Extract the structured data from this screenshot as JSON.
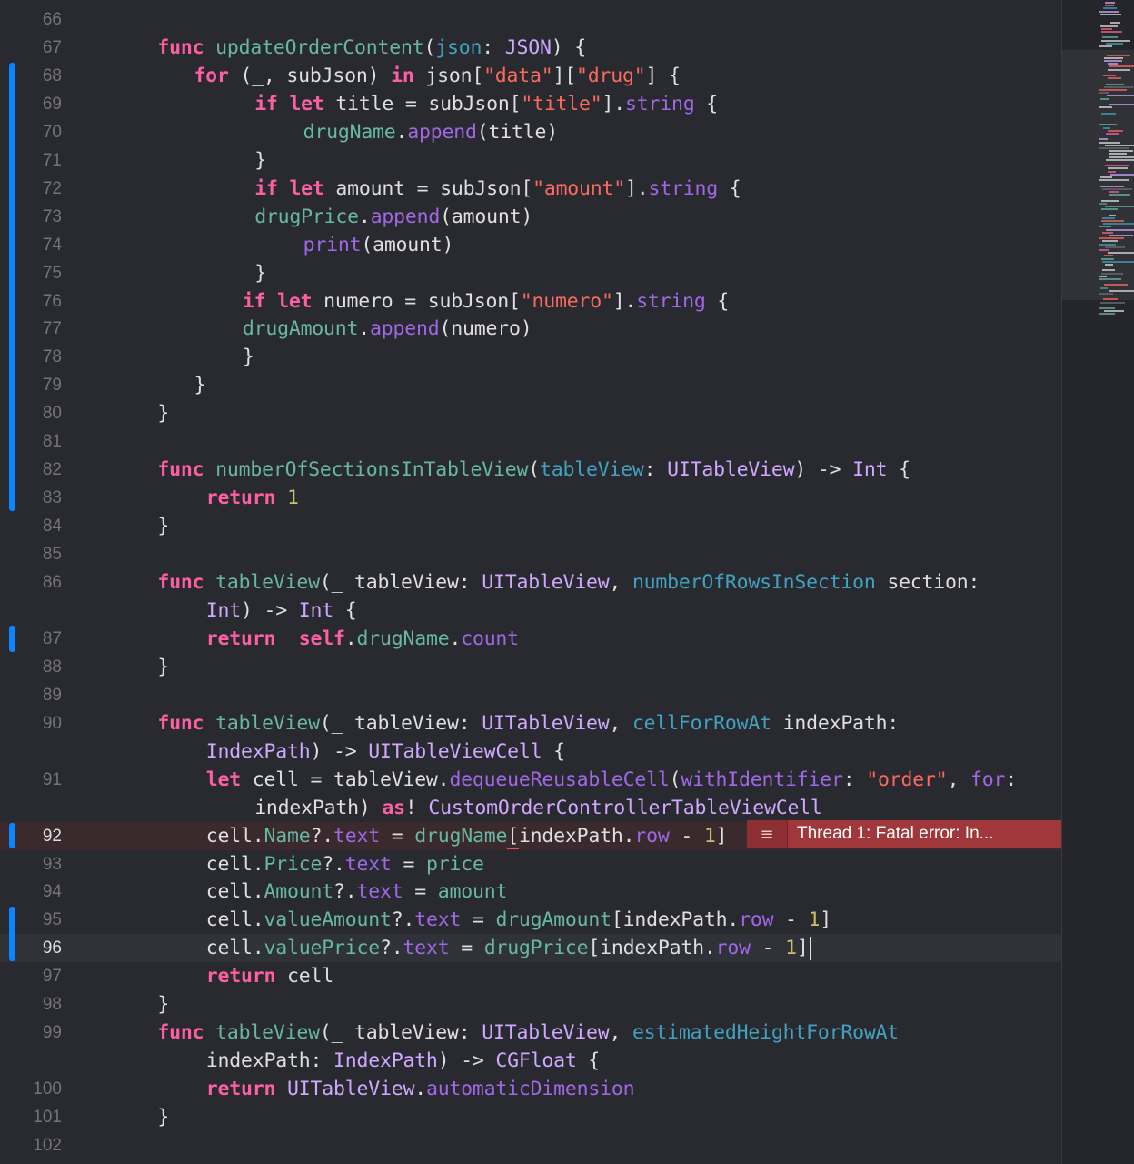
{
  "editor": {
    "lines": [
      {
        "num": "66",
        "indent": 0,
        "tokens": []
      },
      {
        "num": "67",
        "indent": 4,
        "tokens": [
          [
            "kw",
            "func"
          ],
          [
            "pl",
            " "
          ],
          [
            "fn",
            "updateOrderContent"
          ],
          [
            "pl",
            "("
          ],
          [
            "ps",
            "json"
          ],
          [
            "pl",
            ": "
          ],
          [
            "ty",
            "JSON"
          ],
          [
            "pl",
            ") {"
          ]
        ]
      },
      {
        "num": "68",
        "indent": 7,
        "tokens": [
          [
            "kw",
            "for"
          ],
          [
            "pl",
            " (_, subJson) "
          ],
          [
            "kw",
            "in"
          ],
          [
            "pl",
            " json["
          ],
          [
            "str",
            "\"data\""
          ],
          [
            "pl",
            "]["
          ],
          [
            "str",
            "\"drug\""
          ],
          [
            "pl",
            "] {"
          ]
        ]
      },
      {
        "num": "69",
        "indent": 12,
        "tokens": [
          [
            "kw",
            "if"
          ],
          [
            "pl",
            " "
          ],
          [
            "kw",
            "let"
          ],
          [
            "pl",
            " title = subJson["
          ],
          [
            "str",
            "\"title\""
          ],
          [
            "pl",
            "]."
          ],
          [
            "tyc",
            "string"
          ],
          [
            "pl",
            " {"
          ]
        ]
      },
      {
        "num": "70",
        "indent": 16,
        "tokens": [
          [
            "fn",
            "drugName"
          ],
          [
            "pl",
            "."
          ],
          [
            "tyc",
            "append"
          ],
          [
            "pl",
            "(title)"
          ]
        ]
      },
      {
        "num": "71",
        "indent": 12,
        "tokens": [
          [
            "pl",
            "}"
          ]
        ]
      },
      {
        "num": "72",
        "indent": 12,
        "tokens": [
          [
            "kw",
            "if"
          ],
          [
            "pl",
            " "
          ],
          [
            "kw",
            "let"
          ],
          [
            "pl",
            " amount = subJson["
          ],
          [
            "str",
            "\"amount\""
          ],
          [
            "pl",
            "]."
          ],
          [
            "tyc",
            "string"
          ],
          [
            "pl",
            " {"
          ]
        ]
      },
      {
        "num": "73",
        "indent": 12,
        "tokens": [
          [
            "fn",
            "drugPrice"
          ],
          [
            "pl",
            "."
          ],
          [
            "tyc",
            "append"
          ],
          [
            "pl",
            "(amount)"
          ]
        ]
      },
      {
        "num": "74",
        "indent": 16,
        "tokens": [
          [
            "tyc",
            "print"
          ],
          [
            "pl",
            "(amount)"
          ]
        ]
      },
      {
        "num": "75",
        "indent": 12,
        "tokens": [
          [
            "pl",
            "}"
          ]
        ]
      },
      {
        "num": "76",
        "indent": 11,
        "tokens": [
          [
            "kw",
            "if"
          ],
          [
            "pl",
            " "
          ],
          [
            "kw",
            "let"
          ],
          [
            "pl",
            " numero = subJson["
          ],
          [
            "str",
            "\"numero\""
          ],
          [
            "pl",
            "]."
          ],
          [
            "tyc",
            "string"
          ],
          [
            "pl",
            " {"
          ]
        ]
      },
      {
        "num": "77",
        "indent": 11,
        "tokens": [
          [
            "fn",
            "drugAmount"
          ],
          [
            "pl",
            "."
          ],
          [
            "tyc",
            "append"
          ],
          [
            "pl",
            "(numero)"
          ]
        ]
      },
      {
        "num": "78",
        "indent": 11,
        "tokens": [
          [
            "pl",
            "}"
          ]
        ]
      },
      {
        "num": "79",
        "indent": 7,
        "tokens": [
          [
            "pl",
            "}"
          ]
        ]
      },
      {
        "num": "80",
        "indent": 4,
        "tokens": [
          [
            "pl",
            "}"
          ]
        ]
      },
      {
        "num": "81",
        "indent": 0,
        "tokens": []
      },
      {
        "num": "82",
        "indent": 4,
        "tokens": [
          [
            "kw",
            "func"
          ],
          [
            "pl",
            " "
          ],
          [
            "fn",
            "numberOfSectionsInTableView"
          ],
          [
            "pl",
            "("
          ],
          [
            "ps",
            "tableView"
          ],
          [
            "pl",
            ": "
          ],
          [
            "ty",
            "UITableView"
          ],
          [
            "pl",
            ") -> "
          ],
          [
            "ty",
            "Int"
          ],
          [
            "pl",
            " {"
          ]
        ]
      },
      {
        "num": "83",
        "indent": 8,
        "tokens": [
          [
            "kw",
            "return"
          ],
          [
            "pl",
            " "
          ],
          [
            "num",
            "1"
          ]
        ]
      },
      {
        "num": "84",
        "indent": 4,
        "tokens": [
          [
            "pl",
            "}"
          ]
        ]
      },
      {
        "num": "85",
        "indent": 0,
        "tokens": []
      },
      {
        "num": "86",
        "indent": 4,
        "tokens": [
          [
            "kw",
            "func"
          ],
          [
            "pl",
            " "
          ],
          [
            "fn",
            "tableView"
          ],
          [
            "pl",
            "(_ tableView: "
          ],
          [
            "ty",
            "UITableView"
          ],
          [
            "pl",
            ", "
          ],
          [
            "ps",
            "numberOfRowsInSection"
          ],
          [
            "pl",
            " section:"
          ]
        ]
      },
      {
        "num": "",
        "indent": 8,
        "tokens": [
          [
            "ty",
            "Int"
          ],
          [
            "pl",
            ") -> "
          ],
          [
            "ty",
            "Int"
          ],
          [
            "pl",
            " {"
          ]
        ]
      },
      {
        "num": "87",
        "indent": 8,
        "tokens": [
          [
            "kw",
            "return"
          ],
          [
            "pl",
            "  "
          ],
          [
            "kw",
            "self"
          ],
          [
            "pl",
            "."
          ],
          [
            "fn",
            "drugName"
          ],
          [
            "pl",
            "."
          ],
          [
            "tyc",
            "count"
          ]
        ]
      },
      {
        "num": "88",
        "indent": 4,
        "tokens": [
          [
            "pl",
            "}"
          ]
        ]
      },
      {
        "num": "89",
        "indent": 0,
        "tokens": []
      },
      {
        "num": "90",
        "indent": 4,
        "tokens": [
          [
            "kw",
            "func"
          ],
          [
            "pl",
            " "
          ],
          [
            "fn",
            "tableView"
          ],
          [
            "pl",
            "(_ tableView: "
          ],
          [
            "ty",
            "UITableView"
          ],
          [
            "pl",
            ", "
          ],
          [
            "ps",
            "cellForRowAt"
          ],
          [
            "pl",
            " indexPath:"
          ]
        ]
      },
      {
        "num": "",
        "indent": 8,
        "tokens": [
          [
            "ty",
            "IndexPath"
          ],
          [
            "pl",
            ") -> "
          ],
          [
            "ty",
            "UITableViewCell"
          ],
          [
            "pl",
            " {"
          ]
        ]
      },
      {
        "num": "91",
        "indent": 8,
        "tokens": [
          [
            "kw",
            "let"
          ],
          [
            "pl",
            " cell = tableView."
          ],
          [
            "tyc",
            "dequeueReusableCell"
          ],
          [
            "pl",
            "("
          ],
          [
            "tyc",
            "withIdentifier"
          ],
          [
            "pl",
            ": "
          ],
          [
            "str",
            "\"order\""
          ],
          [
            "pl",
            ", "
          ],
          [
            "tyc",
            "for"
          ],
          [
            "pl",
            ":"
          ]
        ]
      },
      {
        "num": "",
        "indent": 12,
        "tokens": [
          [
            "pl",
            "indexPath) "
          ],
          [
            "kw",
            "as"
          ],
          [
            "pl",
            "! "
          ],
          [
            "ty",
            "CustomOrderControllerTableViewCell"
          ]
        ]
      },
      {
        "num": "92",
        "indent": 8,
        "tokens": [
          [
            "pl",
            "cell."
          ],
          [
            "fn",
            "Name"
          ],
          [
            "pl",
            "?."
          ],
          [
            "tyc",
            "text"
          ],
          [
            "pl",
            " = "
          ],
          [
            "fn",
            "drugName"
          ],
          [
            "err",
            "["
          ],
          [
            "pl",
            "indexPath."
          ],
          [
            "tyc",
            "row"
          ],
          [
            "pl",
            " - "
          ],
          [
            "num",
            "1"
          ],
          [
            "pl",
            "]"
          ]
        ]
      },
      {
        "num": "93",
        "indent": 8,
        "tokens": [
          [
            "pl",
            "cell."
          ],
          [
            "fn",
            "Price"
          ],
          [
            "pl",
            "?."
          ],
          [
            "tyc",
            "text"
          ],
          [
            "pl",
            " = "
          ],
          [
            "fn",
            "price"
          ]
        ]
      },
      {
        "num": "94",
        "indent": 8,
        "tokens": [
          [
            "pl",
            "cell."
          ],
          [
            "fn",
            "Amount"
          ],
          [
            "pl",
            "?."
          ],
          [
            "tyc",
            "text"
          ],
          [
            "pl",
            " = "
          ],
          [
            "fn",
            "amount"
          ]
        ]
      },
      {
        "num": "95",
        "indent": 8,
        "tokens": [
          [
            "pl",
            "cell."
          ],
          [
            "fn",
            "valueAmount"
          ],
          [
            "pl",
            "?."
          ],
          [
            "tyc",
            "text"
          ],
          [
            "pl",
            " = "
          ],
          [
            "fn",
            "drugAmount"
          ],
          [
            "pl",
            "[indexPath."
          ],
          [
            "tyc",
            "row"
          ],
          [
            "pl",
            " - "
          ],
          [
            "num",
            "1"
          ],
          [
            "pl",
            "]"
          ]
        ]
      },
      {
        "num": "96",
        "indent": 8,
        "tokens": [
          [
            "pl",
            "cell."
          ],
          [
            "fn",
            "valuePrice"
          ],
          [
            "pl",
            "?."
          ],
          [
            "tyc",
            "text"
          ],
          [
            "pl",
            " = "
          ],
          [
            "fn",
            "drugPrice"
          ],
          [
            "pl",
            "[indexPath."
          ],
          [
            "tyc",
            "row"
          ],
          [
            "pl",
            " - "
          ],
          [
            "num",
            "1"
          ],
          [
            "pl",
            "]"
          ]
        ]
      },
      {
        "num": "97",
        "indent": 8,
        "tokens": [
          [
            "kw",
            "return"
          ],
          [
            "pl",
            " cell"
          ]
        ]
      },
      {
        "num": "98",
        "indent": 4,
        "tokens": [
          [
            "pl",
            "}"
          ]
        ]
      },
      {
        "num": "99",
        "indent": 4,
        "tokens": [
          [
            "kw",
            "func"
          ],
          [
            "pl",
            " "
          ],
          [
            "fn",
            "tableView"
          ],
          [
            "pl",
            "(_ tableView: "
          ],
          [
            "ty",
            "UITableView"
          ],
          [
            "pl",
            ", "
          ],
          [
            "ps",
            "estimatedHeightForRowAt"
          ]
        ]
      },
      {
        "num": "",
        "indent": 8,
        "tokens": [
          [
            "pl",
            "indexPath: "
          ],
          [
            "ty",
            "IndexPath"
          ],
          [
            "pl",
            ") -> "
          ],
          [
            "ty",
            "CGFloat"
          ],
          [
            "pl",
            " {"
          ]
        ]
      },
      {
        "num": "100",
        "indent": 8,
        "tokens": [
          [
            "kw",
            "return"
          ],
          [
            "pl",
            " "
          ],
          [
            "ty",
            "UITableView"
          ],
          [
            "pl",
            "."
          ],
          [
            "tyc",
            "automaticDimension"
          ]
        ]
      },
      {
        "num": "101",
        "indent": 4,
        "tokens": [
          [
            "pl",
            "}"
          ]
        ]
      },
      {
        "num": "102",
        "indent": 0,
        "tokens": []
      }
    ],
    "error": {
      "line": "92",
      "icon": "list-icon",
      "message": "Thread 1: Fatal error: In..."
    },
    "current_line": "96",
    "changed_lines": [
      "68",
      "69",
      "70",
      "71",
      "72",
      "73",
      "74",
      "75",
      "76",
      "77",
      "78",
      "79",
      "80",
      "81",
      "82",
      "83",
      "87",
      "92",
      "95",
      "96"
    ]
  },
  "colors": {
    "background": "#292a30",
    "keyword": "#fc5fa3",
    "function": "#67b7a4",
    "type": "#d0a8ff",
    "string": "#fc6a5d",
    "number": "#d0bf69",
    "change_bar": "#0a84ff",
    "error": "#a0373a"
  }
}
